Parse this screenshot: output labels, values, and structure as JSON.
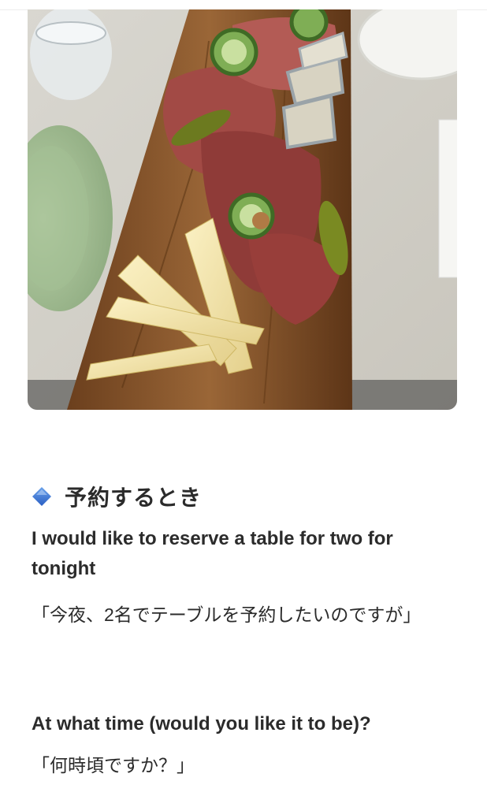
{
  "colors": {
    "text": "#2b2b2b",
    "diamond_top": "#6aa2ea",
    "diamond_bottom": "#2a5fc4",
    "board": "#8a5a2c",
    "cheese": "#f1e3a6",
    "plate": "#a9c49a"
  },
  "photo": {
    "description_icon": "cheese-and-charcuterie-board-image"
  },
  "section": {
    "icon": "blue-diamond-icon",
    "title": "予約するとき"
  },
  "phrases": [
    {
      "english": "I would like to reserve a table for two for tonight",
      "japanese": "「今夜、2名でテーブルを予約したいのですが」"
    },
    {
      "english": "At what time (would you like it to be)?",
      "japanese": "「何時頃ですか？」"
    }
  ]
}
